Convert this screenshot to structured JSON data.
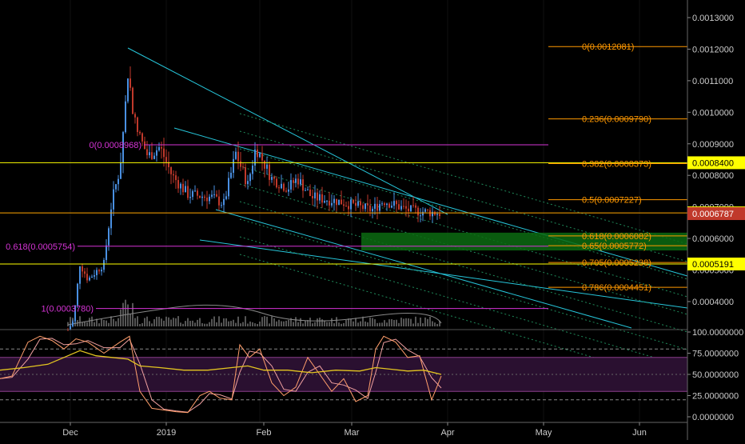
{
  "chart_data": {
    "type": "candlestick",
    "price_axis": {
      "ticks": [
        "0.0013000",
        "0.0012000",
        "0.0011000",
        "0.0010000",
        "0.0009000",
        "0.0008000",
        "0.0007000",
        "0.0006000",
        "0.0005000",
        "0.0004000"
      ],
      "range": [
        0.0003,
        0.00134
      ],
      "badges": [
        {
          "text": "0.0008400",
          "price": 0.00084,
          "bg": "#ffff00",
          "fg": "#000000"
        },
        {
          "text": "0.0006811",
          "price": 0.0006811,
          "bg": "#ffff00",
          "fg": "#000000"
        },
        {
          "text": "0.0006787",
          "price": 0.0006787,
          "bg": "#c0392b",
          "fg": "#ffffff"
        },
        {
          "text": "0.0005191",
          "price": 0.0005191,
          "bg": "#ffff00",
          "fg": "#000000"
        }
      ]
    },
    "oscillator_axis": {
      "ticks": [
        "100.0000000",
        "75.0000000",
        "50.0000000",
        "25.0000000",
        "0.0000000"
      ],
      "range": [
        0,
        100
      ]
    },
    "time_axis": [
      "Dec",
      "2019",
      "Feb",
      "Mar",
      "Apr",
      "May",
      "Jun"
    ],
    "fib_orange": [
      {
        "label": "0(0.0012081)",
        "price": 0.0012081
      },
      {
        "label": "0.236(0.0009790)",
        "price": 0.000979
      },
      {
        "label": "0.382(0.0008373)",
        "price": 0.0008373
      },
      {
        "label": "0.5(0.0007227)",
        "price": 0.0007227
      },
      {
        "label": "0.618(0.0006082)",
        "price": 0.0006082
      },
      {
        "label": "0.65(0.0005772)",
        "price": 0.0005772
      },
      {
        "label": "0.705(0.0005238)",
        "price": 0.0005238
      },
      {
        "label": "0.786(0.0004451)",
        "price": 0.0004451
      }
    ],
    "fib_magenta": [
      {
        "label": "0(0.0008968)",
        "price": 0.0008968
      },
      {
        "label": "0.618(0.0005754)",
        "price": 0.0005754
      },
      {
        "label": "1(0.0003780)",
        "price": 0.000378
      }
    ],
    "horizontal_lines": [
      {
        "price": 0.00084,
        "color": "#ffff00"
      },
      {
        "price": 0.0006811,
        "color": "#ffa500"
      },
      {
        "price": 0.0005191,
        "color": "#ffff00"
      }
    ],
    "green_zone": {
      "from": 0.0005772,
      "to": 0.0006082
    },
    "colors": {
      "up": "#4a90e2",
      "down": "#c0392b",
      "fib": "#ff9800",
      "magenta": "#d633d6",
      "channel": "#26c6da",
      "stoch_k": "#ff9e6b",
      "stoch_d": "#f0a0a0",
      "rsi": "#e3c520"
    }
  }
}
